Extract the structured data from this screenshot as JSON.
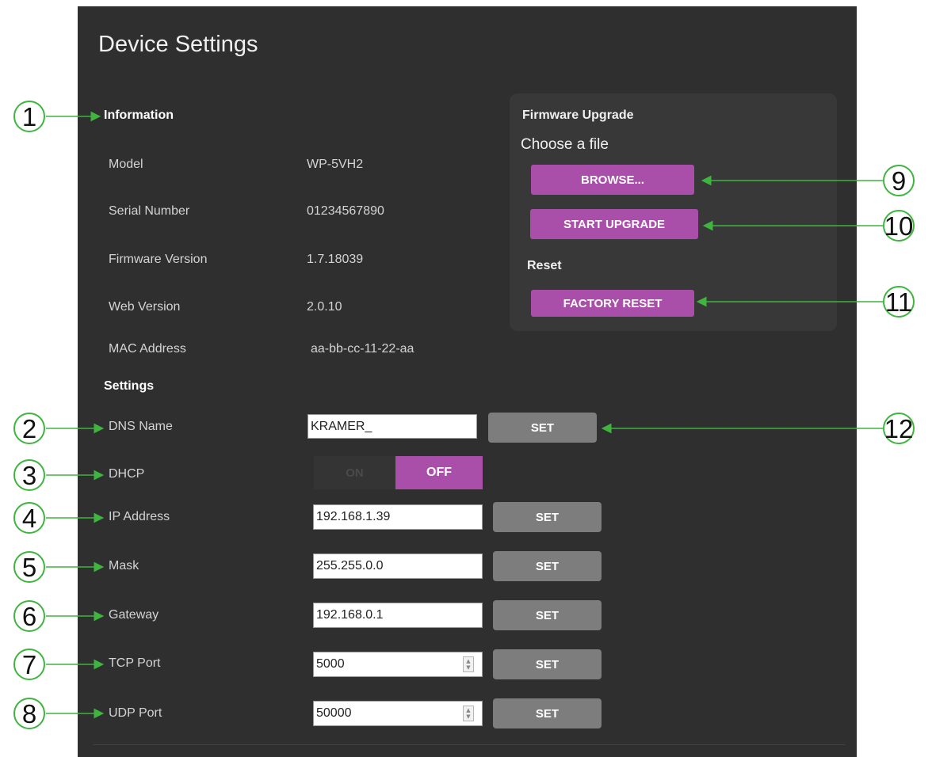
{
  "page": {
    "title": "Device Settings"
  },
  "information": {
    "heading": "Information",
    "rows": [
      {
        "label": "Model",
        "value": "WP-5VH2"
      },
      {
        "label": "Serial Number",
        "value": "01234567890"
      },
      {
        "label": "Firmware Version",
        "value": "1.7.18039"
      },
      {
        "label": "Web Version",
        "value": "2.0.10"
      },
      {
        "label": "MAC Address",
        "value": "aa-bb-cc-11-22-aa"
      }
    ]
  },
  "firmware": {
    "heading": "Firmware Upgrade",
    "choose_label": "Choose a file",
    "browse_label": "BROWSE...",
    "start_upgrade_label": "START UPGRADE",
    "reset_heading": "Reset",
    "factory_reset_label": "FACTORY RESET"
  },
  "settings": {
    "heading": "Settings",
    "dns": {
      "label": "DNS Name",
      "value": "KRAMER_",
      "set_label": "SET"
    },
    "dhcp": {
      "label": "DHCP",
      "on_label": "ON",
      "off_label": "OFF",
      "selected": "OFF"
    },
    "ip": {
      "label": "IP Address",
      "value": "192.168.1.39",
      "set_label": "SET"
    },
    "mask": {
      "label": "Mask",
      "value": "255.255.0.0",
      "set_label": "SET"
    },
    "gateway": {
      "label": "Gateway",
      "value": "192.168.0.1",
      "set_label": "SET"
    },
    "tcp": {
      "label": "TCP Port",
      "value": "5000",
      "set_label": "SET"
    },
    "udp": {
      "label": "UDP Port",
      "value": "50000",
      "set_label": "SET"
    }
  },
  "callouts": [
    "1",
    "2",
    "3",
    "4",
    "5",
    "6",
    "7",
    "8",
    "9",
    "10",
    "11",
    "12"
  ],
  "colors": {
    "panel_bg": "#2f2f2f",
    "accent_purple": "#a94fa9",
    "set_button_gray": "#7d7d7d",
    "callout_green": "#3fb43f"
  }
}
